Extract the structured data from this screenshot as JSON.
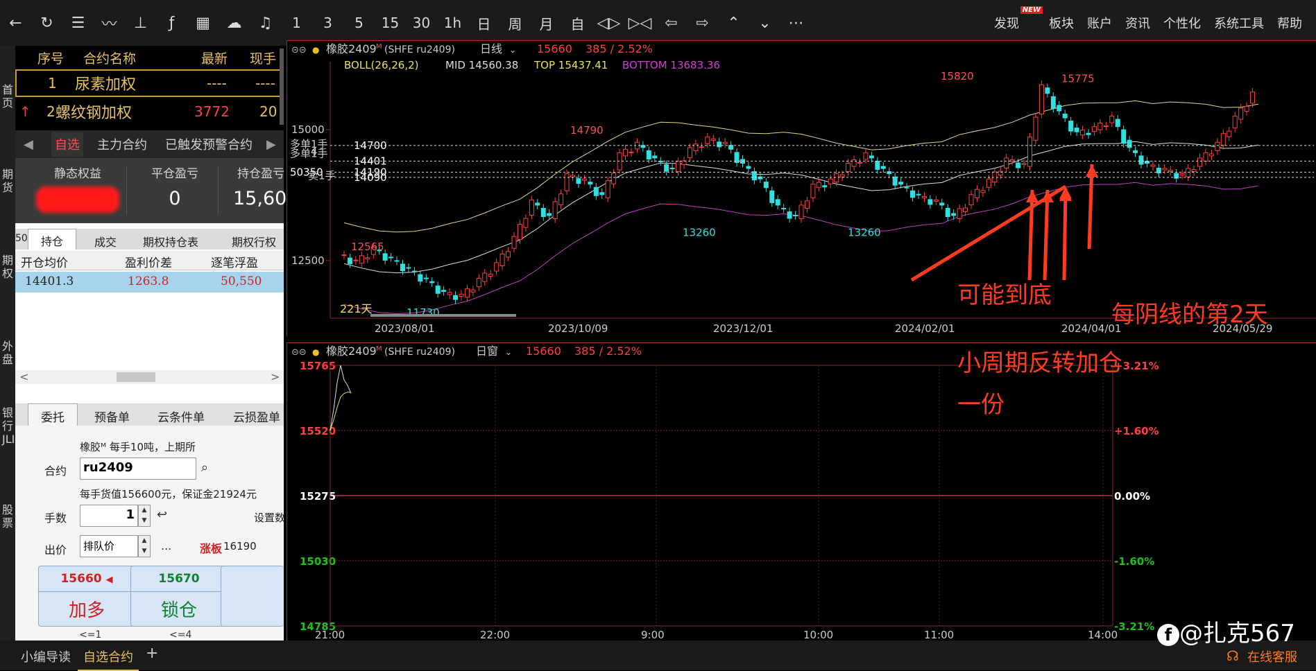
{
  "toolbar": {
    "icons": [
      "back-icon",
      "refresh-icon",
      "list-icon",
      "line-chart-icon",
      "candle-icon",
      "formula-icon",
      "select-icon",
      "cloud-icon",
      "bell-icon"
    ],
    "periods": [
      "1",
      "3",
      "5",
      "15",
      "30",
      "1h",
      "日",
      "周",
      "月",
      "自"
    ],
    "nav": [
      "zoom-in-icon",
      "zoom-out-icon",
      "arrow-left-icon",
      "arrow-right-icon",
      "arrow-up-icon",
      "arrow-down-icon",
      "more-icon"
    ],
    "menu": [
      "发现",
      "板块",
      "账户",
      "资讯",
      "个性化",
      "系统工具",
      "帮助"
    ],
    "new_badge": "NEW"
  },
  "side_strip": [
    "首页",
    "期货",
    "期权",
    "外盘",
    "银行JLIIIT",
    "股票"
  ],
  "watchlist": {
    "headers": [
      "序号",
      "合约名称",
      "最新",
      "现手"
    ],
    "rows": [
      {
        "no": "1",
        "name": "尿素加权",
        "last": "----",
        "vol": "----"
      },
      {
        "no": "2",
        "name": "螺纹钢加权",
        "last": "3772",
        "vol": "20"
      }
    ]
  },
  "tabs1": {
    "items": [
      "自选",
      "主力合约",
      "已触发预警合约"
    ]
  },
  "account": {
    "labels": [
      "静态权益",
      "平仓盈亏",
      "持仓盈亏"
    ],
    "close_pl": "0",
    "pos_pl": "15,60"
  },
  "pos_tabs": [
    "50",
    "持仓",
    "成交",
    "期权持仓表",
    "期权行权"
  ],
  "positions": {
    "headers": [
      "开仓均价",
      "盈利价差",
      "逐笔浮盈"
    ],
    "row": {
      "avg": "14401.3",
      "diff": "1263.8",
      "pl": "50,550"
    }
  },
  "order": {
    "tabs": [
      "委托",
      "预备单",
      "云条件单",
      "云损盈单"
    ],
    "info": "橡胶ᴹ  每手10吨，上期所",
    "contract_label": "合约",
    "contract_value": "ru2409",
    "value_info": "每手货值156600元，保证金21924元",
    "qty_label": "手数",
    "qty_value": "1",
    "set_label": "设置数",
    "price_label": "出价",
    "price_value": "排队价",
    "ellipsis": "...",
    "limit_label": "涨板",
    "limit_value": "16190",
    "btn1": {
      "price": "15660",
      "label": "加多",
      "sub": "<=1"
    },
    "btn2": {
      "price": "15670",
      "label": "锁仓",
      "sub": "<=4"
    }
  },
  "bottom": {
    "tabs": [
      "小编导读",
      "自选合约"
    ],
    "add": "+",
    "service": "在线客服",
    "watermark": "@扎克567"
  },
  "chart_main": {
    "title": "橡胶2409",
    "title_sup": "M",
    "code": "(SHFE ru2409)",
    "period": "日线",
    "price": "15660",
    "change": "385 / 2.52%",
    "boll": "BOLL(26,26,2)",
    "mid": "MID 14560.38",
    "top": "TOP 15437.41",
    "bottom": "BOTTOM 13683.36",
    "count": "221天",
    "position_lines": [
      "多单1手",
      "4",
      "14700",
      "14401",
      "多单1手",
      "14190",
      "50350",
      "卖1手",
      "14090"
    ],
    "annotations": [
      "可能到底",
      "每阴线的第2天",
      "小周期反转加仓",
      "一份"
    ]
  },
  "chart_intraday": {
    "title": "橡胶2409",
    "title_sup": "M",
    "code": "(SHFE ru2409)",
    "period": "日窗",
    "price": "15660",
    "change": "385 / 2.52%"
  },
  "chart_data": [
    {
      "type": "candlestick",
      "title": "",
      "x_ticks": [
        "2023/08/01",
        "2023/10/09",
        "2023/12/01",
        "2024/02/01",
        "2024/04/01",
        "2024/05/29"
      ],
      "y_ticks": [
        12500,
        15000
      ],
      "ylim": [
        11400,
        16300
      ],
      "price_labels": [
        {
          "label": "12565",
          "value": 12565
        },
        {
          "label": "11730",
          "value": 11730
        },
        {
          "label": "14790",
          "value": 14790
        },
        {
          "label": "13260",
          "value": 13260
        },
        {
          "label": "13260",
          "value": 13260
        },
        {
          "label": "15820",
          "value": 15820
        },
        {
          "label": "15775",
          "value": 15775
        }
      ],
      "close_path": [
        12600,
        12450,
        12700,
        12500,
        12300,
        12100,
        11850,
        11800,
        12100,
        12400,
        12900,
        13600,
        13300,
        14100,
        14000,
        13700,
        14500,
        14700,
        14400,
        14200,
        14600,
        14800,
        14700,
        14300,
        14000,
        13500,
        13300,
        13900,
        14000,
        14300,
        14500,
        14200,
        13900,
        13700,
        13600,
        13300,
        13700,
        14000,
        14400,
        14300,
        15800,
        15300,
        14900,
        15000,
        15200,
        14600,
        14300,
        14200,
        14100,
        14400,
        14700,
        15200,
        15660
      ]
    },
    {
      "type": "line",
      "title": "",
      "x_ticks": [
        "21:00",
        "22:00",
        "9:00",
        "10:00",
        "11:00",
        "14:00"
      ],
      "y_ticks": [
        15765,
        15520,
        15275,
        15030,
        14785
      ],
      "right_ticks": [
        "+3.21%",
        "+1.60%",
        "0.00%",
        "-1.60%",
        "-3.21%"
      ],
      "ylim": [
        14785,
        15765
      ],
      "values": [
        15520,
        15600,
        15700,
        15765,
        15710,
        15690,
        15660
      ]
    }
  ]
}
